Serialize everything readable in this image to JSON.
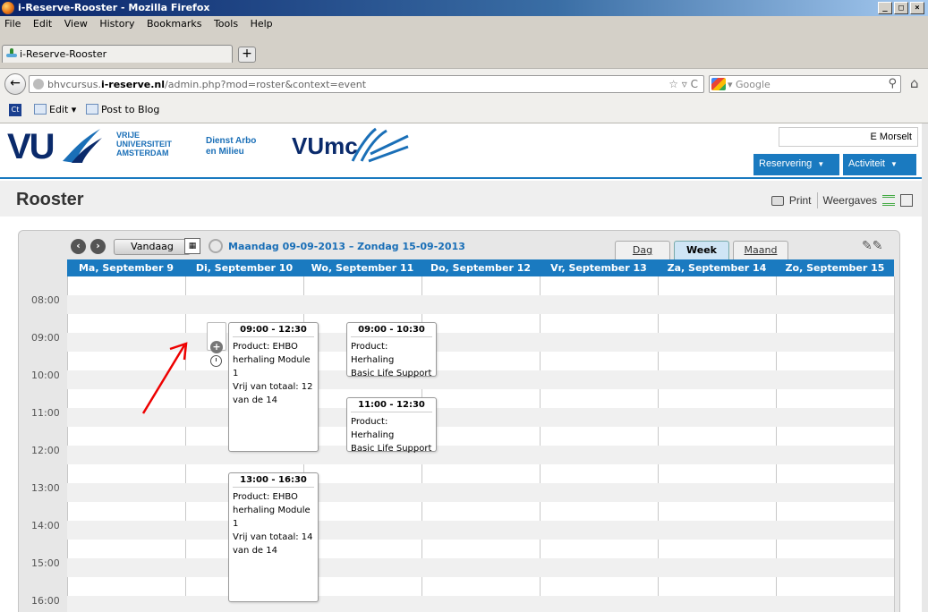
{
  "window": {
    "title": "i-Reserve-Rooster - Mozilla Firefox",
    "buttons": [
      "_",
      "□",
      "×"
    ]
  },
  "menu": [
    "File",
    "Edit",
    "View",
    "History",
    "Bookmarks",
    "Tools",
    "Help"
  ],
  "tab": {
    "label": "i-Reserve-Rooster",
    "new_tab": "+"
  },
  "nav": {
    "url_prefix": "bhvcursus.",
    "url_domain": "i-reserve.nl",
    "url_path": "/admin.php?mod=roster&context=event",
    "url_icons": "☆ ▿ C",
    "search_engine": "▾ Google"
  },
  "bookmarks": {
    "ct": "Ct",
    "edit": "Edit ▾",
    "blog": "Post to Blog"
  },
  "site": {
    "vu": "VU",
    "vu_text": [
      "VRIJE",
      "UNIVERSITEIT",
      "AMSTERDAM"
    ],
    "dienst": [
      "Dienst Arbo",
      "en Milieu"
    ],
    "vumc": "VUmc",
    "user": "E Morselt",
    "menu_reservering": "Reservering",
    "menu_activiteit": "Activiteit"
  },
  "page": {
    "title": "Rooster",
    "print": "Print",
    "weergaves": "Weergaves"
  },
  "calendar": {
    "today": "Vandaag",
    "range": "Maandag 09-09-2013 – Zondag 15-09-2013",
    "views": [
      "Dag",
      "Week",
      "Maand"
    ],
    "active_view": "Week",
    "days": [
      "Ma, September 9",
      "Di, September 10",
      "Wo, September 11",
      "Do, September 12",
      "Vr, September 13",
      "Za, September 14",
      "Zo, September 15"
    ],
    "times": [
      "08:00",
      "09:00",
      "10:00",
      "11:00",
      "12:00",
      "13:00",
      "14:00",
      "15:00",
      "16:00"
    ],
    "events": [
      {
        "time": "09:00 - 12:30",
        "lines": [
          "Product: EHBO",
          "herhaling Module 1",
          "Vrij van totaal: 12",
          "van de 14"
        ]
      },
      {
        "time": "13:00 - 16:30",
        "lines": [
          "Product: EHBO",
          "herhaling Module 1",
          "Vrij van totaal: 14",
          "van de 14"
        ]
      },
      {
        "time": "09:00 - 10:30",
        "lines": [
          "Product: Herhaling",
          "Basic Life Support"
        ]
      },
      {
        "time": "11:00 - 12:30",
        "lines": [
          "Product: Herhaling",
          "Basic Life Support"
        ]
      }
    ]
  }
}
